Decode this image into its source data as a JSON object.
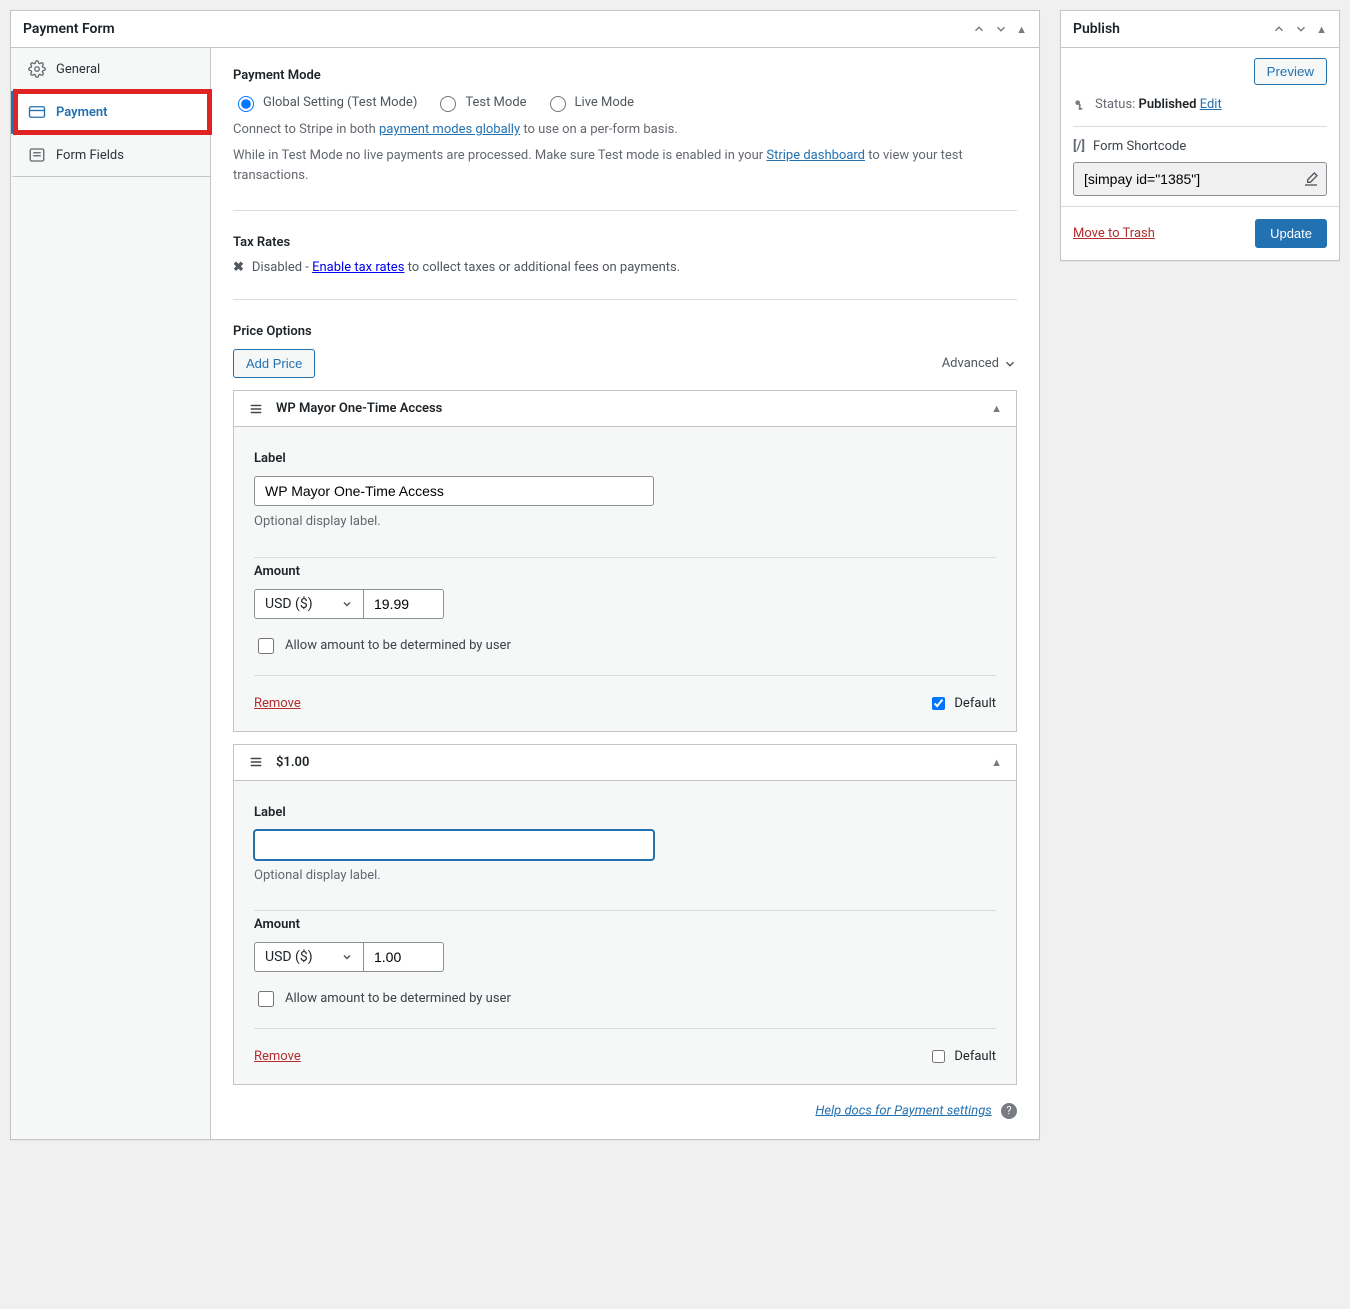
{
  "main": {
    "title": "Payment Form",
    "tabs": {
      "general": "General",
      "payment": "Payment",
      "form_fields": "Form Fields"
    },
    "payment_mode": {
      "heading": "Payment Mode",
      "options": {
        "global": "Global Setting (Test Mode)",
        "test": "Test Mode",
        "live": "Live Mode"
      },
      "desc1_a": "Connect to Stripe in both ",
      "desc1_link": "payment modes globally",
      "desc1_b": " to use on a per-form basis.",
      "desc2_a": "While in Test Mode no live payments are processed. Make sure Test mode is enabled in your ",
      "desc2_link": "Stripe dashboard",
      "desc2_b": " to view your test transactions."
    },
    "tax": {
      "heading": "Tax Rates",
      "disabled_label": "Disabled - ",
      "enable_link": "Enable tax rates",
      "suffix": " to collect taxes or additional fees on payments."
    },
    "prices": {
      "heading": "Price Options",
      "add_price": "Add Price",
      "advanced": "Advanced",
      "label_heading": "Label",
      "label_hint": "Optional display label.",
      "amount_heading": "Amount",
      "currency_display": "USD ($)",
      "allow_user_amount": "Allow amount to be determined by user",
      "remove": "Remove",
      "default": "Default",
      "items": [
        {
          "title": "WP Mayor One-Time Access",
          "label_value": "WP Mayor One-Time Access",
          "amount": "19.99",
          "is_default": true,
          "focused": false
        },
        {
          "title": "$1.00",
          "label_value": "",
          "amount": "1.00",
          "is_default": false,
          "focused": true
        }
      ]
    },
    "help_docs": "Help docs for Payment settings"
  },
  "publish": {
    "title": "Publish",
    "preview": "Preview",
    "status_label": "Status: ",
    "status_value": "Published",
    "edit": "Edit",
    "shortcode_label": "Form Shortcode",
    "shortcode_value": "[simpay id=\"1385\"]",
    "trash": "Move to Trash",
    "update": "Update"
  }
}
